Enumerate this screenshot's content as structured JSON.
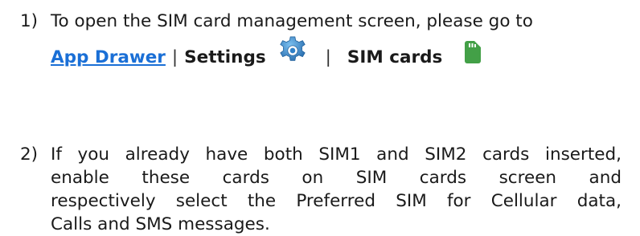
{
  "step1": {
    "number": "1)",
    "text": "To open the SIM card management screen, please go to",
    "path": {
      "app_drawer": "App Drawer",
      "separator": "|",
      "settings": "Settings",
      "sim_cards": "SIM cards"
    },
    "icons": [
      "gear-icon",
      "sim-card-icon"
    ]
  },
  "step2": {
    "number": "2)",
    "lines": [
      "If you already have both SIM1 and SIM2 cards inserted,",
      "enable these cards on SIM cards screen and",
      "respectively select the Preferred SIM for Cellular data,",
      "Calls and SMS messages."
    ]
  },
  "colors": {
    "link": "#1a6fd6",
    "gear": "#2f80c8",
    "sim_card": "#43a047",
    "text": "#1a1a1a"
  }
}
